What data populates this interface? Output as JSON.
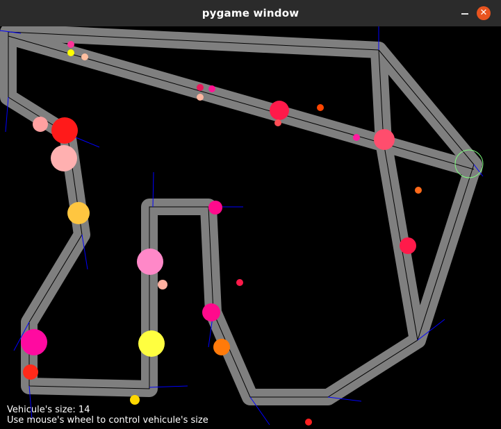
{
  "window": {
    "title": "pygame window",
    "close_glyph": "✕"
  },
  "colors": {
    "road": "#7f7f7f",
    "center_line": "#000000",
    "sensor_ray": "#0000ff",
    "target_ring": "#7fff7f"
  },
  "hud": {
    "size_line": "Vehicule's size: 14",
    "help_line": "Use mouse's wheel to control vehicule's size"
  },
  "vehicle_size": 14,
  "vehicles": [
    {
      "color": "#ff3399",
      "size": 5
    },
    {
      "color": "#ffff00",
      "size": 5
    },
    {
      "color": "#ffbfa0",
      "size": 5
    },
    {
      "color": "#e8185a",
      "size": 5
    },
    {
      "color": "#ff1493",
      "size": 5
    },
    {
      "color": "#ffb6a0",
      "size": 5
    },
    {
      "color": "#ff1a4a",
      "size": 14
    },
    {
      "color": "#ff4d55",
      "size": 5
    },
    {
      "color": "#ff4500",
      "size": 5
    },
    {
      "color": "#ff1aa0",
      "size": 5
    },
    {
      "color": "#ff4d6d",
      "size": 15
    },
    {
      "color": "#ffa0a0",
      "size": 11
    },
    {
      "color": "#ff1a1a",
      "size": 19
    },
    {
      "color": "#ffb0b0",
      "size": 19
    },
    {
      "color": "#ffc640",
      "size": 16
    },
    {
      "color": "#ff0a8c",
      "size": 10
    },
    {
      "color": "#ff1a4a",
      "size": 12
    },
    {
      "color": "#ff6a1a",
      "size": 5
    },
    {
      "color": "#ff88c8",
      "size": 19
    },
    {
      "color": "#ffb0a0",
      "size": 7
    },
    {
      "color": "#ff1a4a",
      "size": 5
    },
    {
      "color": "#ff0a8c",
      "size": 13
    },
    {
      "color": "#ff7a0a",
      "size": 12
    },
    {
      "color": "#ff0aa0",
      "size": 19
    },
    {
      "color": "#ff2a1a",
      "size": 11
    },
    {
      "color": "#ffff40",
      "size": 19
    },
    {
      "color": "#ffd700",
      "size": 7
    },
    {
      "color": "#ff2020",
      "size": 5
    }
  ]
}
